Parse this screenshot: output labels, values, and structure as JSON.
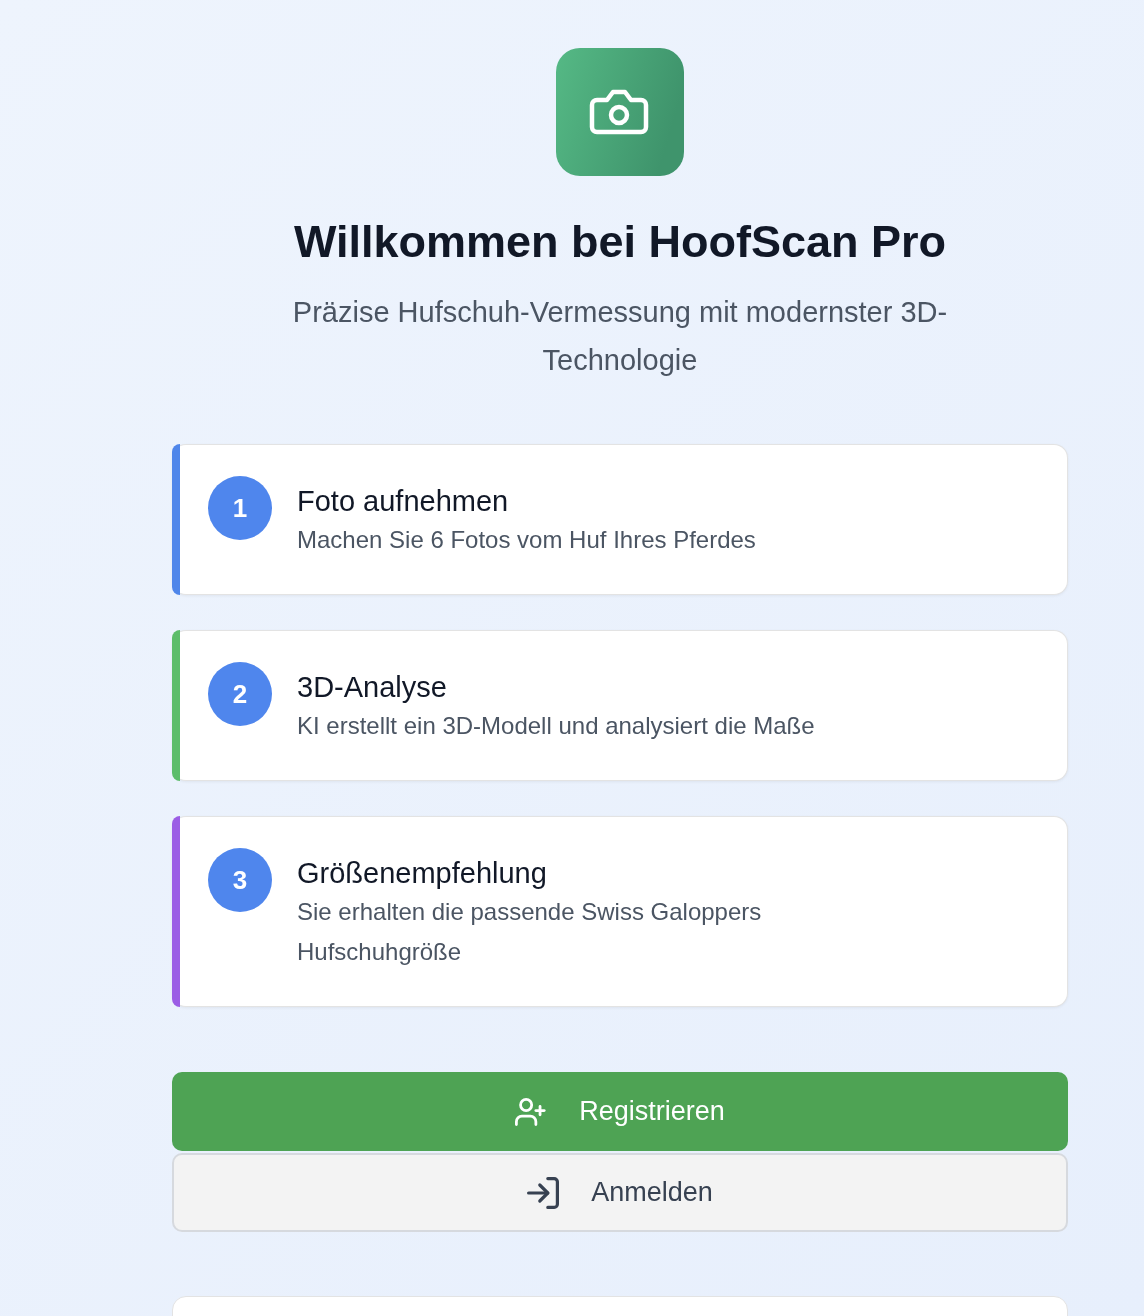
{
  "header": {
    "title": "Willkommen bei HoofScan Pro",
    "subtitle": "Präzise Hufschuh-Vermessung mit modernster 3D-Technologie"
  },
  "steps": [
    {
      "number": "1",
      "title": "Foto aufnehmen",
      "description": "Machen Sie 6 Fotos vom Huf Ihres Pferdes",
      "color": "#4f86ea"
    },
    {
      "number": "2",
      "title": "3D-Analyse",
      "description": "KI erstellt ein 3D-Modell und analysiert die Maße",
      "color": "#5cbd6a"
    },
    {
      "number": "3",
      "title": "Größenempfehlung",
      "description": "Sie erhalten die passende Swiss Galoppers Hufschuhgröße",
      "color": "#9b5de5"
    }
  ],
  "buttons": [
    {
      "kind": "register",
      "label": "Registrieren"
    },
    {
      "kind": "login",
      "label": "Anmelden"
    }
  ]
}
